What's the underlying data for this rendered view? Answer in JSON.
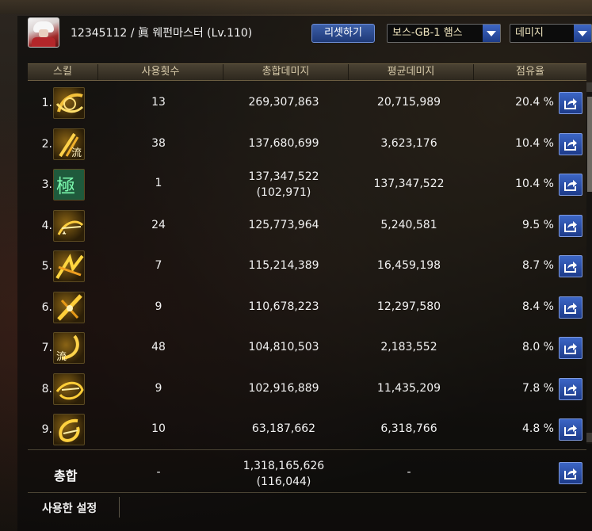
{
  "header": {
    "char_info": "12345112 / 眞 웨펀마스터 (Lv.110)",
    "reset_label": "리셋하기",
    "target_select": "보스-GB-1 햄스",
    "metric_select": "데미지"
  },
  "columns": [
    "스킬",
    "사용횟수",
    "총합데미지",
    "평균데미지",
    "점유율"
  ],
  "rows": [
    {
      "rank": "1.",
      "icon": "slash-crescent-icon",
      "uses": "13",
      "total": "269,307,863",
      "total_sub": "",
      "avg": "20,715,989",
      "share": "20.4 %"
    },
    {
      "rank": "2.",
      "icon": "flow-slash-icon",
      "uses": "38",
      "total": "137,680,699",
      "total_sub": "",
      "avg": "3,623,176",
      "share": "10.4 %"
    },
    {
      "rank": "3.",
      "icon": "kanji-emblem-icon",
      "uses": "1",
      "total": "137,347,522",
      "total_sub": "(102,971)",
      "avg": "137,347,522",
      "share": "10.4 %"
    },
    {
      "rank": "4.",
      "icon": "thrust-spark-icon",
      "uses": "24",
      "total": "125,773,964",
      "total_sub": "",
      "avg": "5,240,581",
      "share": "9.5 %"
    },
    {
      "rank": "5.",
      "icon": "burst-slash-icon",
      "uses": "7",
      "total": "115,214,389",
      "total_sub": "",
      "avg": "16,459,198",
      "share": "8.7 %"
    },
    {
      "rank": "6.",
      "icon": "blade-storm-icon",
      "uses": "9",
      "total": "110,678,223",
      "total_sub": "",
      "avg": "12,297,580",
      "share": "8.4 %"
    },
    {
      "rank": "7.",
      "icon": "flow-crescent-icon",
      "uses": "48",
      "total": "104,810,503",
      "total_sub": "",
      "avg": "2,183,552",
      "share": "8.0 %"
    },
    {
      "rank": "8.",
      "icon": "whirl-slash-icon",
      "uses": "9",
      "total": "102,916,889",
      "total_sub": "",
      "avg": "11,435,209",
      "share": "7.8 %"
    },
    {
      "rank": "9.",
      "icon": "spiral-cut-icon",
      "uses": "10",
      "total": "63,187,662",
      "total_sub": "",
      "avg": "6,318,766",
      "share": "4.8 %"
    }
  ],
  "total": {
    "label": "총합",
    "uses": "-",
    "total": "1,318,165,626",
    "total_sub": "(116,044)",
    "avg": "-"
  },
  "footer": {
    "settings_label": "사용한 설정"
  },
  "colors": {
    "accent_blue": "#2a4fa8",
    "gold": "#d9a521"
  }
}
